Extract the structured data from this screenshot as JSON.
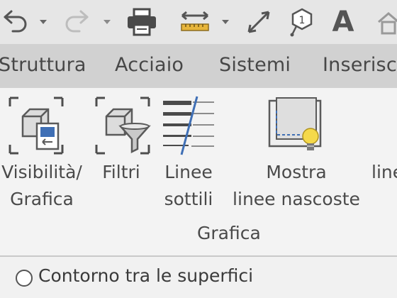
{
  "quick_access": {
    "tools": [
      {
        "icon": "undo-icon"
      },
      {
        "icon": "undo-dropdown-icon"
      },
      {
        "icon": "redo-icon"
      },
      {
        "icon": "redo-dropdown-icon"
      },
      {
        "icon": "print-icon"
      },
      {
        "icon": "measure-icon"
      },
      {
        "icon": "measure-dropdown-icon"
      },
      {
        "icon": "aligned-dimension-icon"
      },
      {
        "icon": "tag-icon"
      },
      {
        "icon": "text-icon"
      }
    ],
    "text_tool_letter": "A",
    "tag_number": "1"
  },
  "tabs": [
    "Struttura",
    "Acciaio",
    "Sistemi",
    "Inserisci"
  ],
  "ribbon": {
    "buttons": [
      {
        "icon": "visibility-graphics-icon",
        "line1": "Visibilità/",
        "line2": "Grafica"
      },
      {
        "icon": "filters-icon",
        "line1": "Filtri",
        "line2": ""
      },
      {
        "icon": "thin-lines-icon",
        "line1": "Linee",
        "line2": "sottili"
      },
      {
        "icon": "show-hidden-lines-icon",
        "line1": "Mostra",
        "line2": "linee nascoste"
      },
      {
        "icon": "",
        "line1": "",
        "line2": "line"
      }
    ],
    "panel_title": "Grafica"
  },
  "options": {
    "radio_label": "Contorno tra le superfici",
    "radio_selected": false
  },
  "colors": {
    "qat_background": "#e6e6e6",
    "tab_strip": "#d1d1d1",
    "ribbon_background": "#f3f3f3",
    "icon_blue": "#3f6fb5",
    "bulb_yellow": "#f5d94a"
  }
}
